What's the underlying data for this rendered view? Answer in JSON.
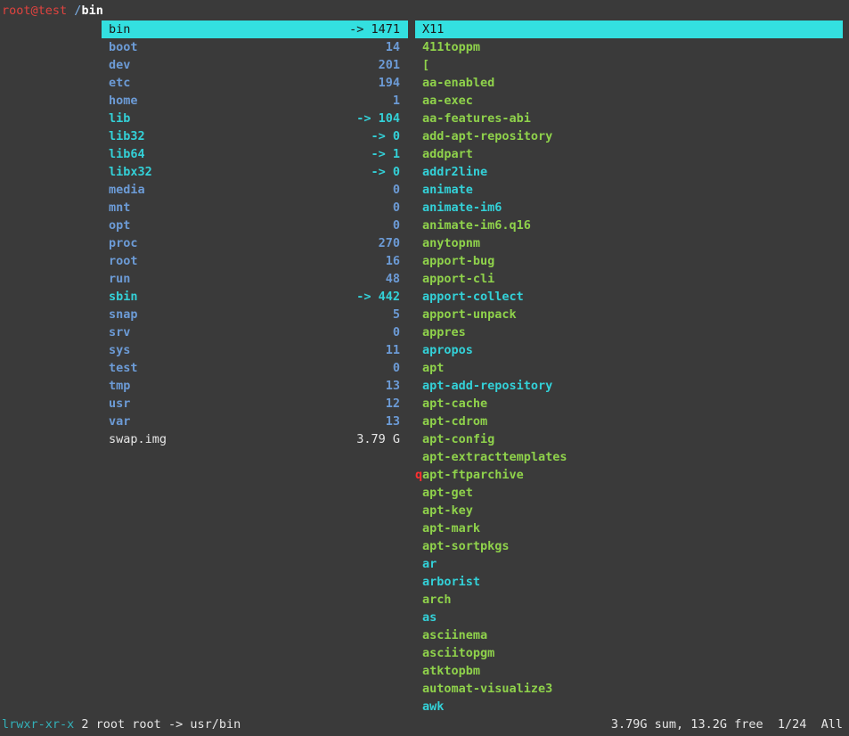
{
  "title": {
    "user": "root@test",
    "path": "/",
    "current": "bin"
  },
  "left_pane": [
    {
      "name": "bin",
      "info": "-> 1471",
      "kind": "link",
      "selected": true
    },
    {
      "name": "boot",
      "info": "14",
      "kind": "dir"
    },
    {
      "name": "dev",
      "info": "201",
      "kind": "dir"
    },
    {
      "name": "etc",
      "info": "194",
      "kind": "dir"
    },
    {
      "name": "home",
      "info": "1",
      "kind": "dir"
    },
    {
      "name": "lib",
      "info": "-> 104",
      "kind": "link"
    },
    {
      "name": "lib32",
      "info": "-> 0",
      "kind": "link"
    },
    {
      "name": "lib64",
      "info": "-> 1",
      "kind": "link"
    },
    {
      "name": "libx32",
      "info": "-> 0",
      "kind": "link"
    },
    {
      "name": "media",
      "info": "0",
      "kind": "dir"
    },
    {
      "name": "mnt",
      "info": "0",
      "kind": "dir"
    },
    {
      "name": "opt",
      "info": "0",
      "kind": "dir"
    },
    {
      "name": "proc",
      "info": "270",
      "kind": "dir"
    },
    {
      "name": "root",
      "info": "16",
      "kind": "dir"
    },
    {
      "name": "run",
      "info": "48",
      "kind": "dir"
    },
    {
      "name": "sbin",
      "info": "-> 442",
      "kind": "link"
    },
    {
      "name": "snap",
      "info": "5",
      "kind": "dir"
    },
    {
      "name": "srv",
      "info": "0",
      "kind": "dir"
    },
    {
      "name": "sys",
      "info": "11",
      "kind": "dir"
    },
    {
      "name": "test",
      "info": "0",
      "kind": "dir"
    },
    {
      "name": "tmp",
      "info": "13",
      "kind": "dir"
    },
    {
      "name": "usr",
      "info": "12",
      "kind": "dir"
    },
    {
      "name": "var",
      "info": "13",
      "kind": "dir"
    },
    {
      "name": "swap.img",
      "info": "3.79 G",
      "kind": "file"
    }
  ],
  "right_pane": [
    {
      "name": "X11",
      "kind": "elink",
      "selected": true
    },
    {
      "name": "411toppm",
      "kind": "exec"
    },
    {
      "name": "[",
      "kind": "exec"
    },
    {
      "name": "aa-enabled",
      "kind": "exec"
    },
    {
      "name": "aa-exec",
      "kind": "exec"
    },
    {
      "name": "aa-features-abi",
      "kind": "exec"
    },
    {
      "name": "add-apt-repository",
      "kind": "exec"
    },
    {
      "name": "addpart",
      "kind": "exec"
    },
    {
      "name": "addr2line",
      "kind": "elink"
    },
    {
      "name": "animate",
      "kind": "elink"
    },
    {
      "name": "animate-im6",
      "kind": "elink"
    },
    {
      "name": "animate-im6.q16",
      "kind": "exec"
    },
    {
      "name": "anytopnm",
      "kind": "exec"
    },
    {
      "name": "apport-bug",
      "kind": "exec"
    },
    {
      "name": "apport-cli",
      "kind": "exec"
    },
    {
      "name": "apport-collect",
      "kind": "elink"
    },
    {
      "name": "apport-unpack",
      "kind": "exec"
    },
    {
      "name": "appres",
      "kind": "exec"
    },
    {
      "name": "apropos",
      "kind": "elink"
    },
    {
      "name": "apt",
      "kind": "exec"
    },
    {
      "name": "apt-add-repository",
      "kind": "elink"
    },
    {
      "name": "apt-cache",
      "kind": "exec"
    },
    {
      "name": "apt-cdrom",
      "kind": "exec"
    },
    {
      "name": "apt-config",
      "kind": "exec"
    },
    {
      "name": "apt-extracttemplates",
      "kind": "exec"
    },
    {
      "name": "apt-ftparchive",
      "kind": "exec",
      "mark": "q"
    },
    {
      "name": "apt-get",
      "kind": "exec"
    },
    {
      "name": "apt-key",
      "kind": "exec"
    },
    {
      "name": "apt-mark",
      "kind": "exec"
    },
    {
      "name": "apt-sortpkgs",
      "kind": "exec"
    },
    {
      "name": "ar",
      "kind": "elink"
    },
    {
      "name": "arborist",
      "kind": "elink"
    },
    {
      "name": "arch",
      "kind": "exec"
    },
    {
      "name": "as",
      "kind": "elink"
    },
    {
      "name": "asciinema",
      "kind": "exec"
    },
    {
      "name": "asciitopgm",
      "kind": "exec"
    },
    {
      "name": "atktopbm",
      "kind": "exec"
    },
    {
      "name": "automat-visualize3",
      "kind": "exec"
    },
    {
      "name": "awk",
      "kind": "elink"
    }
  ],
  "status": {
    "perms": "lrwxr-xr-x",
    "details": " 2 root root -> usr/bin",
    "right": "3.79G sum, 13.2G free  1/24  All"
  },
  "colors": {
    "background": "#3a3a3a",
    "selection": "#33e0e0",
    "directory": "#6c9bd6",
    "symlink": "#33d1d8",
    "executable": "#8fd24b",
    "user": "#e0433f",
    "mark": "#ff3030"
  }
}
